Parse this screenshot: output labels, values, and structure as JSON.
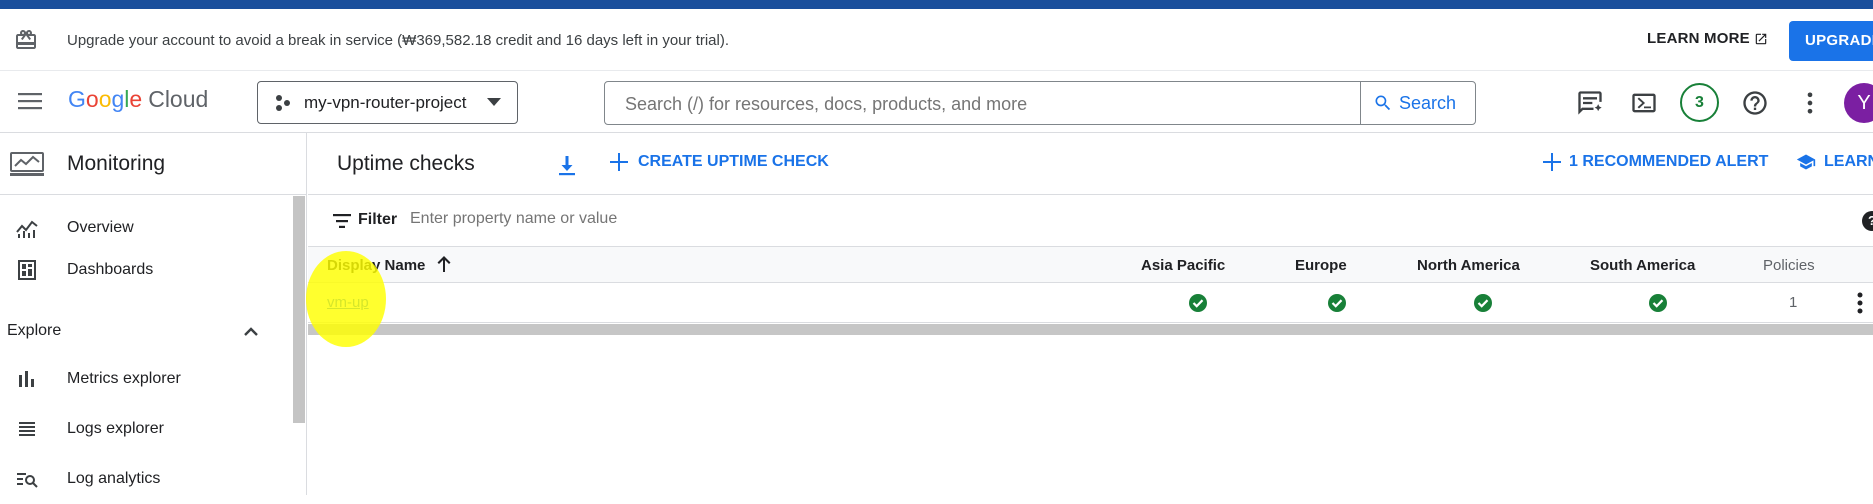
{
  "banner": {
    "text": "Upgrade your account to avoid a break in service (₩369,582.18 credit and 16 days left in your trial).",
    "learn_more": "LEARN MORE",
    "upgrade": "UPGRADE"
  },
  "header": {
    "logo_letters": [
      "G",
      "o",
      "o",
      "g",
      "l",
      "e"
    ],
    "logo_product": "Cloud",
    "project": "my-vpn-router-project",
    "search_placeholder": "Search (/) for resources, docs, products, and more",
    "search_button": "Search",
    "notification_count": "3",
    "avatar_initial": "Y"
  },
  "sidebar": {
    "title": "Monitoring",
    "items": [
      {
        "label": "Overview",
        "icon": "overview-icon"
      },
      {
        "label": "Dashboards",
        "icon": "dashboards-icon"
      }
    ],
    "section": "Explore",
    "explore_items": [
      {
        "label": "Metrics explorer",
        "icon": "metrics-icon"
      },
      {
        "label": "Logs explorer",
        "icon": "logs-icon"
      },
      {
        "label": "Log analytics",
        "icon": "log-analytics-icon"
      }
    ]
  },
  "main": {
    "title": "Uptime checks",
    "create_label": "CREATE UPTIME CHECK",
    "recommended_label": "1 RECOMMENDED ALERT",
    "learn_label": "LEARN",
    "filter_label": "Filter",
    "filter_placeholder": "Enter property name or value",
    "columns": [
      "Display Name",
      "Asia Pacific",
      "Europe",
      "North America",
      "South America",
      "Policies"
    ],
    "rows": [
      {
        "name": "vm-up",
        "asia_pacific": "pass",
        "europe": "pass",
        "north_america": "pass",
        "south_america": "pass",
        "policies": "1"
      }
    ]
  },
  "colors": {
    "accent": "#1a73e8",
    "success": "#188038",
    "top_strip": "#1a4f9c",
    "highlight": "#ffff00"
  }
}
